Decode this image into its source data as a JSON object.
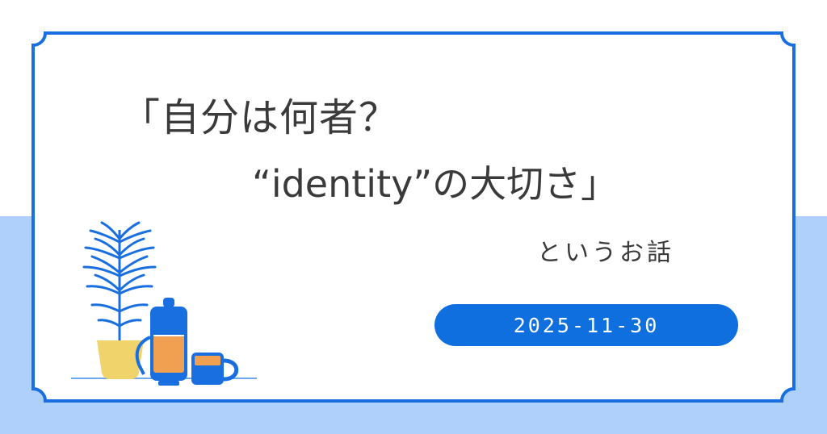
{
  "title": {
    "line1": "「自分は何者？",
    "line2": "“identity”の大切さ」",
    "line3": "というお話"
  },
  "date": "2025-11-30",
  "colors": {
    "frame": "#1a6fe0",
    "badge": "#0f6fde",
    "background_bottom": "#aed0fb",
    "text": "#3a3a3a",
    "plant_pot": "#f0d36a",
    "coffee": "#f0a050"
  },
  "illustration": {
    "items": [
      "plant-icon",
      "plant-pot-icon",
      "coffee-press-icon",
      "coffee-mug-icon"
    ]
  }
}
